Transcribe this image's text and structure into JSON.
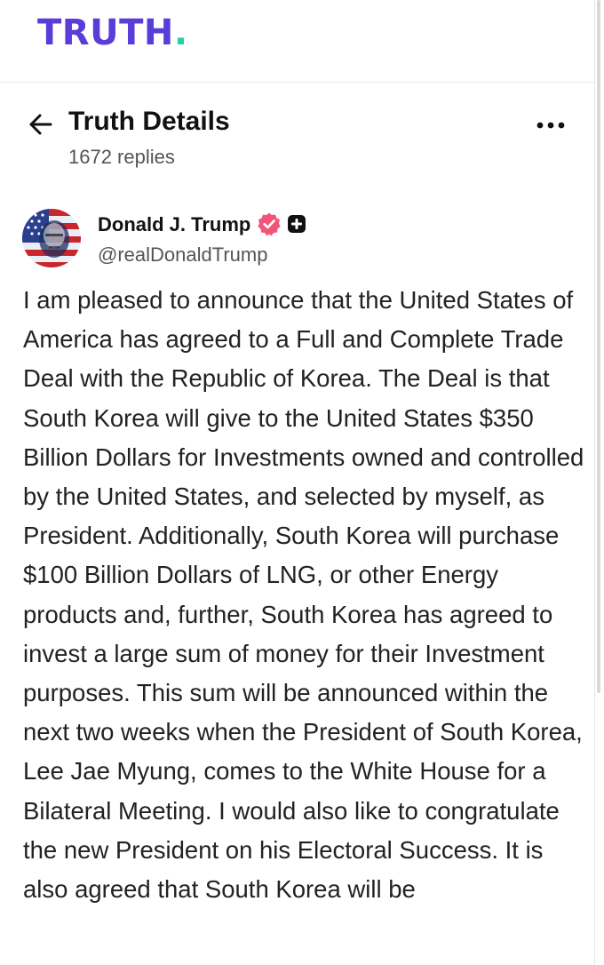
{
  "header": {
    "logo_text": "TRUTH",
    "logo_dot": ".",
    "brand_color": "#5a3dd8",
    "accent_color": "#1ed3a6"
  },
  "details": {
    "back_icon": "arrow-left-icon",
    "title": "Truth Details",
    "replies": "1672 replies",
    "more_icon": "more-horizontal-icon"
  },
  "author": {
    "name": "Donald J. Trump",
    "handle": "@realDonaldTrump",
    "verified_icon": "verified-badge-icon",
    "verified_color": "#f0557a",
    "plus_icon": "plus-badge-icon"
  },
  "post": {
    "text": "I am pleased to announce that the United States of America has agreed to a Full and Complete Trade Deal with the Republic of Korea. The Deal is that South Korea will give to the United States $350 Billion Dollars for Investments owned and controlled by the United States, and selected by myself, as President. Additionally, South Korea will purchase $100 Billion Dollars of LNG, or other Energy products and, further, South Korea has agreed to invest a large sum of money for their Investment purposes. This sum will be announced within the next two weeks when the President of South Korea, Lee Jae Myung, comes to the White House for a Bilateral Meeting. I would also like to congratulate the new President on his Electoral Success. It is also agreed that South Korea will be"
  }
}
